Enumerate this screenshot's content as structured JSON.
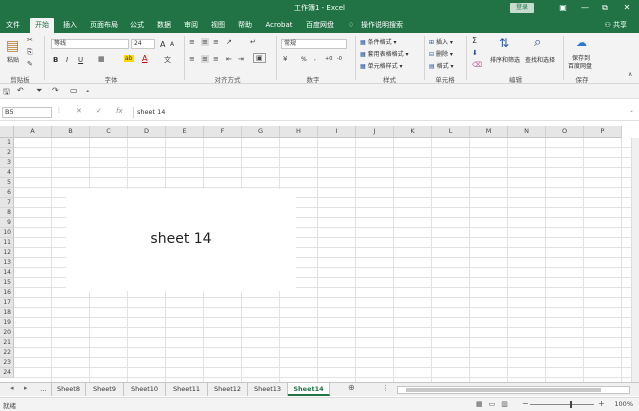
{
  "window": {
    "title": "工作簿1 - Excel",
    "login": "登录",
    "minimize": "—",
    "restore": "⧉",
    "close": "✕"
  },
  "ribbon_tabs": [
    "文件",
    "开始",
    "插入",
    "页面布局",
    "公式",
    "数据",
    "审阅",
    "视图",
    "帮助",
    "Acrobat",
    "百度网盘",
    "操作说明搜索"
  ],
  "active_tab": "开始",
  "share": "共享",
  "ribbon": {
    "clipboard": {
      "label": "剪贴板",
      "paste": "粘贴"
    },
    "font": {
      "label": "字体",
      "font_name": "等线",
      "font_size": "24",
      "bold": "B",
      "italic": "I",
      "underline": "U",
      "grow": "A",
      "shrink": "A",
      "font_color": "A",
      "highlight": "ab"
    },
    "alignment": {
      "label": "对齐方式"
    },
    "number": {
      "label": "数字",
      "format": "常规",
      "percent": "%",
      "comma": ",",
      "inc": "+0",
      "dec": "-0"
    },
    "styles": {
      "label": "样式",
      "conditional": "条件格式",
      "table": "套用表格格式",
      "cell": "单元格样式"
    },
    "cells": {
      "label": "单元格",
      "insert": "插入",
      "delete": "删除",
      "format": "格式"
    },
    "editing": {
      "label": "编辑",
      "sum": "Σ",
      "sort": "排序和筛选",
      "find": "查找和选择"
    },
    "save": {
      "label": "保存",
      "save_to": "保存到",
      "baidu": "百度网盘"
    }
  },
  "formula_bar": {
    "name_box": "B5",
    "cancel": "✕",
    "confirm": "✓",
    "fx": "fx",
    "formula": "sheet 14"
  },
  "columns": [
    "A",
    "B",
    "C",
    "D",
    "E",
    "F",
    "G",
    "H",
    "I",
    "J",
    "K",
    "L",
    "M",
    "N",
    "O",
    "P"
  ],
  "rows": [
    "1",
    "2",
    "3",
    "4",
    "5",
    "6",
    "7",
    "8",
    "9",
    "10",
    "11",
    "12",
    "13",
    "14",
    "15",
    "16",
    "17",
    "18",
    "19",
    "20",
    "21",
    "22",
    "23",
    "24"
  ],
  "textbox_text": "sheet 14",
  "sheets": [
    "...",
    "Sheet8",
    "Sheet9",
    "Sheet10",
    "Sheet11",
    "Sheet12",
    "Sheet13",
    "Sheet14"
  ],
  "active_sheet": "Sheet14",
  "add_sheet": "⊕",
  "status": {
    "ready": "就绪",
    "zoom": "100%",
    "zoom_minus": "−",
    "zoom_plus": "+"
  }
}
